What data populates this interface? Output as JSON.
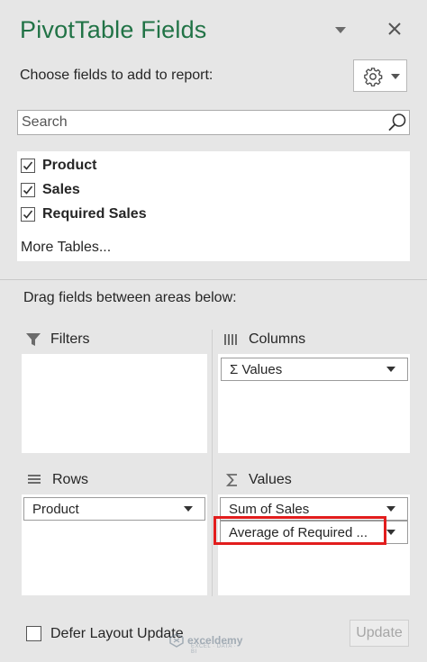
{
  "panel": {
    "title": "PivotTable Fields",
    "choose_label": "Choose fields to add to report:",
    "accent_color": "#217346"
  },
  "search": {
    "placeholder": "Search",
    "value": ""
  },
  "fields": [
    {
      "label": "Product",
      "checked": true
    },
    {
      "label": "Sales",
      "checked": true
    },
    {
      "label": "Required Sales",
      "checked": true
    }
  ],
  "more_tables_label": "More Tables...",
  "drag_label": "Drag fields between areas below:",
  "areas": {
    "filters": {
      "label": "Filters",
      "icon": "filter-icon",
      "items": []
    },
    "columns": {
      "label": "Columns",
      "icon": "columns-icon",
      "items": [
        "Σ  Values"
      ]
    },
    "rows": {
      "label": "Rows",
      "icon": "rows-icon",
      "items": [
        "Product"
      ]
    },
    "values": {
      "label": "Values",
      "icon": "sigma-icon",
      "items": [
        "Sum of Sales",
        "Average of Required ..."
      ]
    }
  },
  "footer": {
    "defer_label": "Defer Layout Update",
    "defer_checked": false,
    "update_label": "Update"
  },
  "watermark": {
    "name": "exceldemy",
    "tagline": "EXCEL · DATA · BI"
  },
  "highlight_color": "#e21d1d"
}
